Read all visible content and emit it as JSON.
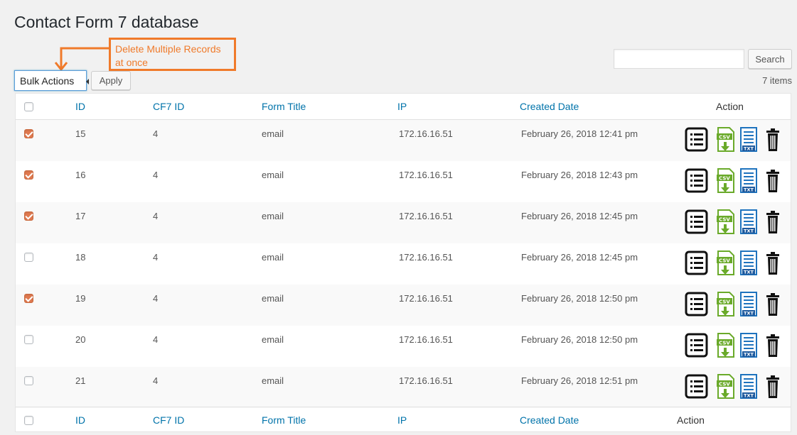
{
  "page": {
    "title": "Contact Form 7 database"
  },
  "annotation": {
    "text": "Delete Multiple Records at once",
    "color": "#f07a2a"
  },
  "toolbar": {
    "bulk_actions_label": "Bulk Actions",
    "apply_label": "Apply",
    "search_label": "Search",
    "search_value": "",
    "items_count": "7 items"
  },
  "table": {
    "columns": {
      "id": "ID",
      "cf7_id": "CF7 ID",
      "form_title": "Form Title",
      "ip": "IP",
      "created_date": "Created Date",
      "action": "Action"
    },
    "rows": [
      {
        "checked": true,
        "id": "15",
        "cf7_id": "4",
        "form_title": "email",
        "ip": "172.16.16.51",
        "created_date": "February 26, 2018 12:41 pm"
      },
      {
        "checked": true,
        "id": "16",
        "cf7_id": "4",
        "form_title": "email",
        "ip": "172.16.16.51",
        "created_date": "February 26, 2018 12:43 pm"
      },
      {
        "checked": true,
        "id": "17",
        "cf7_id": "4",
        "form_title": "email",
        "ip": "172.16.16.51",
        "created_date": "February 26, 2018 12:45 pm"
      },
      {
        "checked": false,
        "id": "18",
        "cf7_id": "4",
        "form_title": "email",
        "ip": "172.16.16.51",
        "created_date": "February 26, 2018 12:45 pm"
      },
      {
        "checked": true,
        "id": "19",
        "cf7_id": "4",
        "form_title": "email",
        "ip": "172.16.16.51",
        "created_date": "February 26, 2018 12:50 pm"
      },
      {
        "checked": false,
        "id": "20",
        "cf7_id": "4",
        "form_title": "email",
        "ip": "172.16.16.51",
        "created_date": "February 26, 2018 12:50 pm"
      },
      {
        "checked": false,
        "id": "21",
        "cf7_id": "4",
        "form_title": "email",
        "ip": "172.16.16.51",
        "created_date": "February 26, 2018 12:51 pm"
      }
    ],
    "action_icons": [
      "view-list-icon",
      "csv-download-icon",
      "txt-download-icon",
      "trash-icon"
    ],
    "icon_labels": {
      "csv": "CSV",
      "txt": "TXT"
    }
  },
  "colors": {
    "link": "#0073aa",
    "checkbox_checked": "#e07a50",
    "csv_green": "#6aaa2a",
    "txt_blue": "#1e73be"
  }
}
